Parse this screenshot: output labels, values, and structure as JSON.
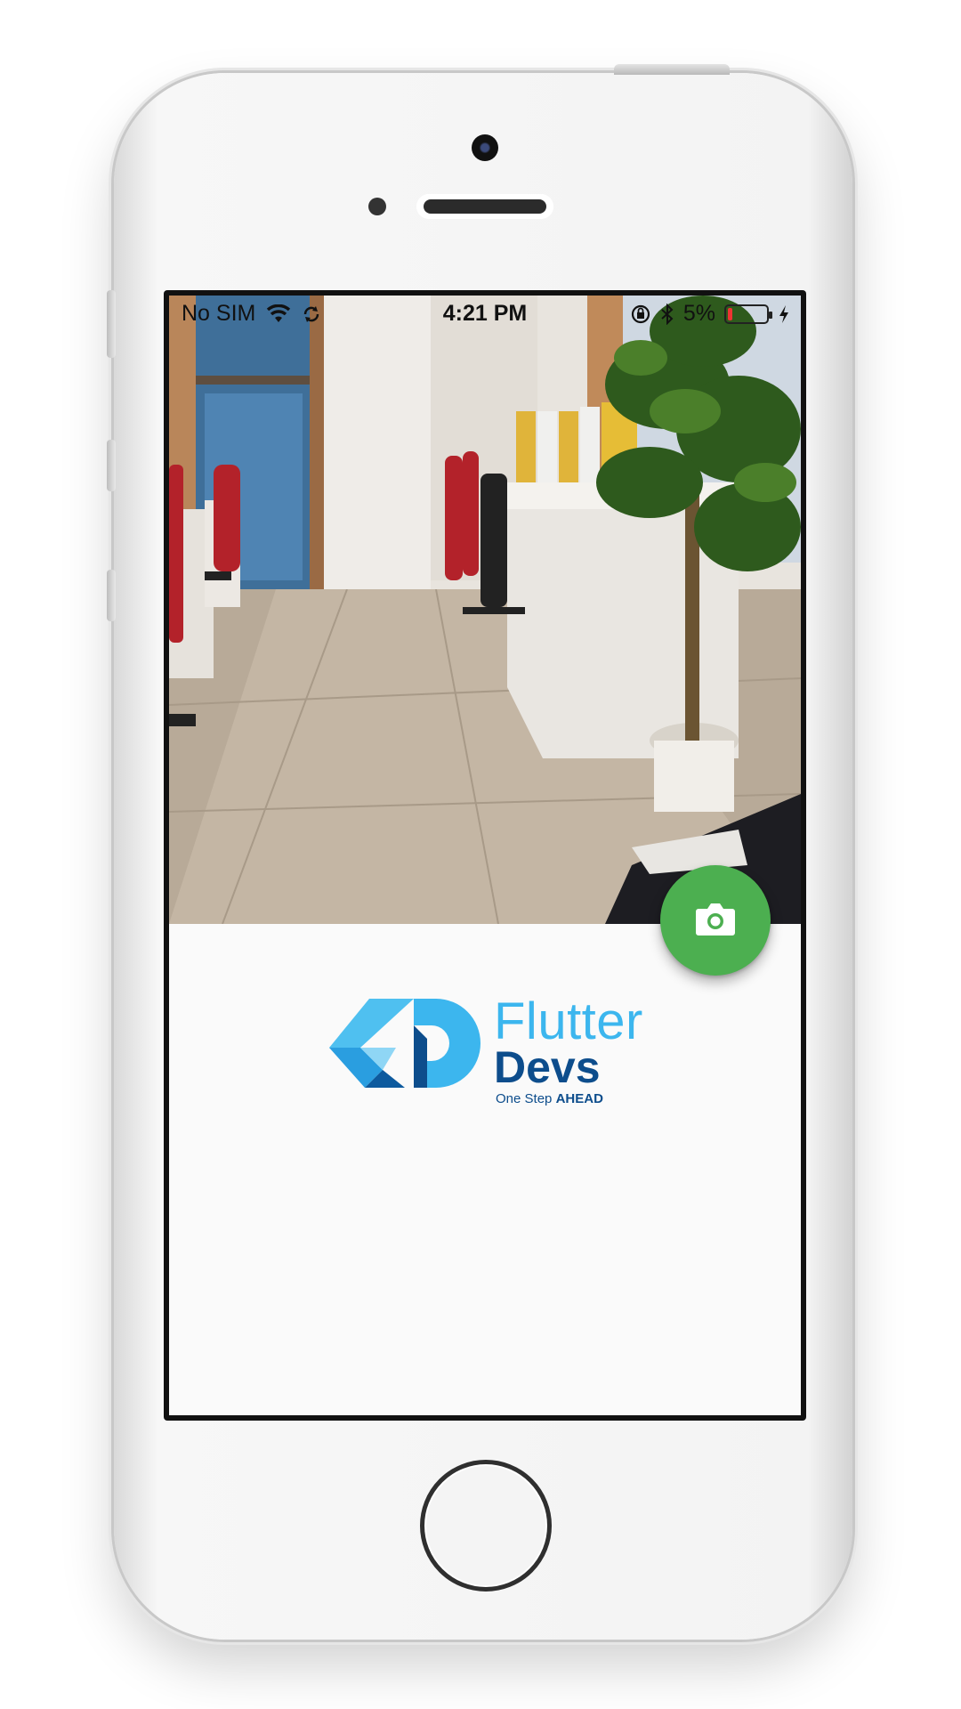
{
  "status_bar": {
    "carrier": "No SIM",
    "time": "4:21 PM",
    "battery_percent": "5%",
    "battery_level": 0.05,
    "icons": [
      "wifi-icon",
      "sync-icon",
      "orientation-lock-icon",
      "bluetooth-icon",
      "battery-icon",
      "charging-icon"
    ]
  },
  "camera_preview": {
    "description_icon": "camera-preview"
  },
  "fab": {
    "icon": "camera-icon",
    "color": "#4caf50"
  },
  "logo": {
    "line1": "Flutter",
    "line2": "Devs",
    "tagline_prefix": "One Step",
    "tagline_emphasis": "AHEAD",
    "colors": {
      "light": "#3cb6ee",
      "dark": "#0d4d8c"
    }
  }
}
